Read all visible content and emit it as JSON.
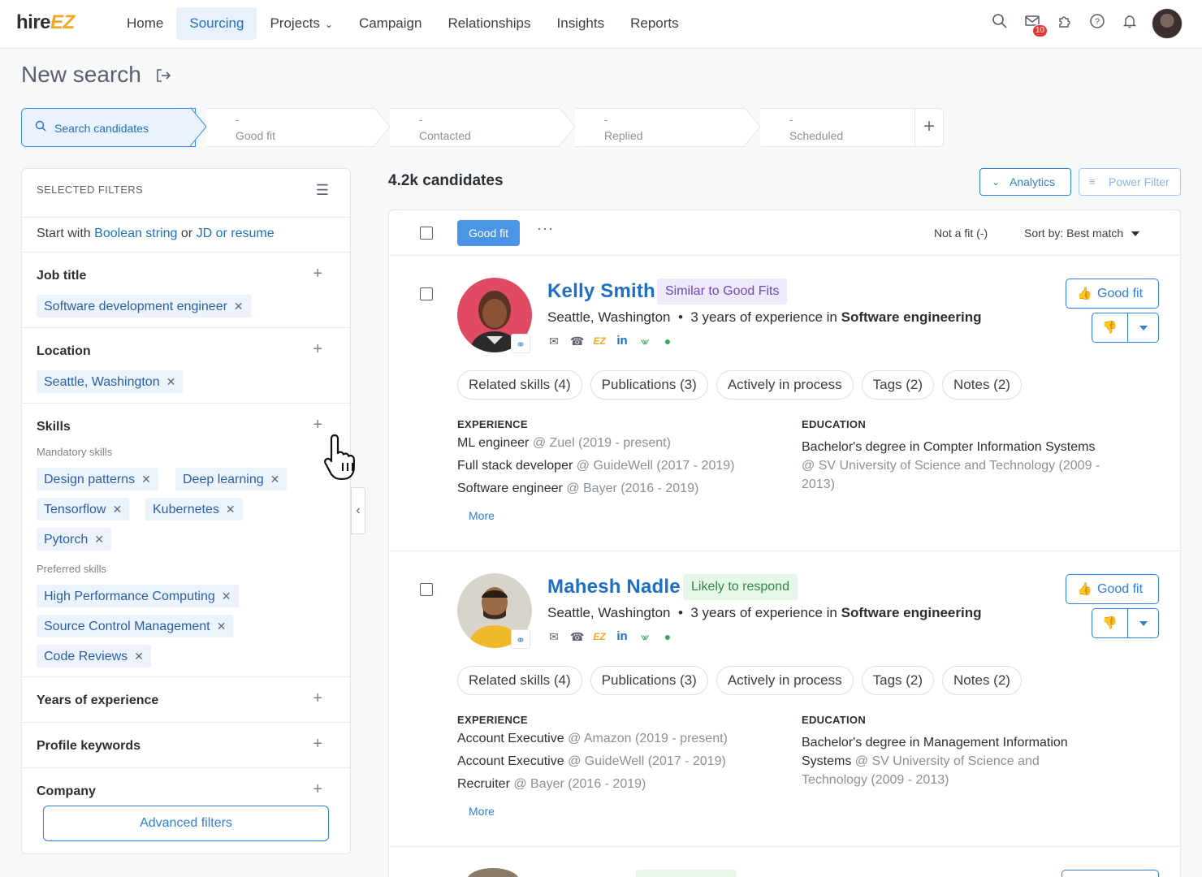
{
  "app": {
    "logo_main": "hire",
    "logo_accent": "EZ"
  },
  "nav": {
    "items": [
      "Home",
      "Sourcing",
      "Projects",
      "Campaign",
      "Relationships",
      "Insights",
      "Reports"
    ],
    "active": "Sourcing",
    "notification_count": "10"
  },
  "page": {
    "title": "New search"
  },
  "stepper": {
    "search_label": "Search candidates",
    "steps": [
      {
        "count": "-",
        "label": "Good fit"
      },
      {
        "count": "-",
        "label": "Contacted"
      },
      {
        "count": "-",
        "label": "Replied"
      },
      {
        "count": "-",
        "label": "Scheduled"
      }
    ]
  },
  "filters": {
    "header": "SELECTED FILTERS",
    "start_with": "Start with",
    "boolean_link": "Boolean string",
    "or": "or",
    "jd_link": "JD or resume",
    "job_title": {
      "label": "Job title",
      "chips": [
        "Software development engineer"
      ]
    },
    "location": {
      "label": "Location",
      "chips": [
        "Seattle, Washington"
      ]
    },
    "skills": {
      "label": "Skills",
      "mandatory_label": "Mandatory skills",
      "mandatory": [
        "Design patterns",
        "Deep learning",
        "Tensorflow",
        "Kubernetes",
        "Pytorch"
      ],
      "preferred_label": "Preferred skills",
      "preferred": [
        "High Performance Computing",
        "Source Control Management",
        "Code Reviews"
      ]
    },
    "years": "Years of experience",
    "keywords": "Profile keywords",
    "company": "Company",
    "advanced_button": "Advanced filters"
  },
  "results": {
    "count": "4.2k candidates",
    "analytics_button": "Analytics",
    "power_filter_button": "Power Filter",
    "good_fit_tab": "Good fit",
    "not_fit": "Not a fit (-)",
    "sort": "Sort by: Best match",
    "good_fit_button": "Good fit",
    "experience_header": "EXPERIENCE",
    "education_header": "EDUCATION",
    "more_link": "More",
    "candidates": [
      {
        "name": "Kelly Smith",
        "tag": "Similar to Good Fits",
        "location": "Seattle, Washington",
        "exp_years": "3 years of experience in",
        "field": "Software engineering",
        "pills": [
          "Related skills (4)",
          "Publications (3)",
          "Actively in process",
          "Tags (2)",
          "Notes (2)"
        ],
        "experience": [
          {
            "role": "ML engineer",
            "org": "@ Zuel (2019 - present)"
          },
          {
            "role": "Full stack developer",
            "org": "@ GuideWell (2017 - 2019)"
          },
          {
            "role": "Software engineer",
            "org": "@ Bayer (2016 - 2019)"
          }
        ],
        "education_degree": "Bachelor's degree in Compter Information Systems",
        "education_school": "@ SV University of Science and Technology (2009 - 2013)"
      },
      {
        "name": "Mahesh Nadle",
        "tag": "Likely to respond",
        "location": "Seattle, Washington",
        "exp_years": "3 years of experience in",
        "field": "Software engineering",
        "pills": [
          "Related skills (4)",
          "Publications (3)",
          "Actively in process",
          "Tags (2)",
          "Notes (2)"
        ],
        "experience": [
          {
            "role": "Account Executive",
            "org": "@ Amazon (2019 - present)"
          },
          {
            "role": "Account Executive",
            "org": "@ GuideWell (2017 - 2019)"
          },
          {
            "role": "Recruiter",
            "org": "@ Bayer (2016 - 2019)"
          }
        ],
        "education_degree": "Bachelor's degree in Management Information Systems",
        "education_school": "@ SV University of Science and Technology (2009 - 2013)"
      }
    ]
  },
  "colors": {
    "accent": "#1f6fc5",
    "brand_orange": "#f5a623",
    "chip_bg": "#edf3fb"
  }
}
